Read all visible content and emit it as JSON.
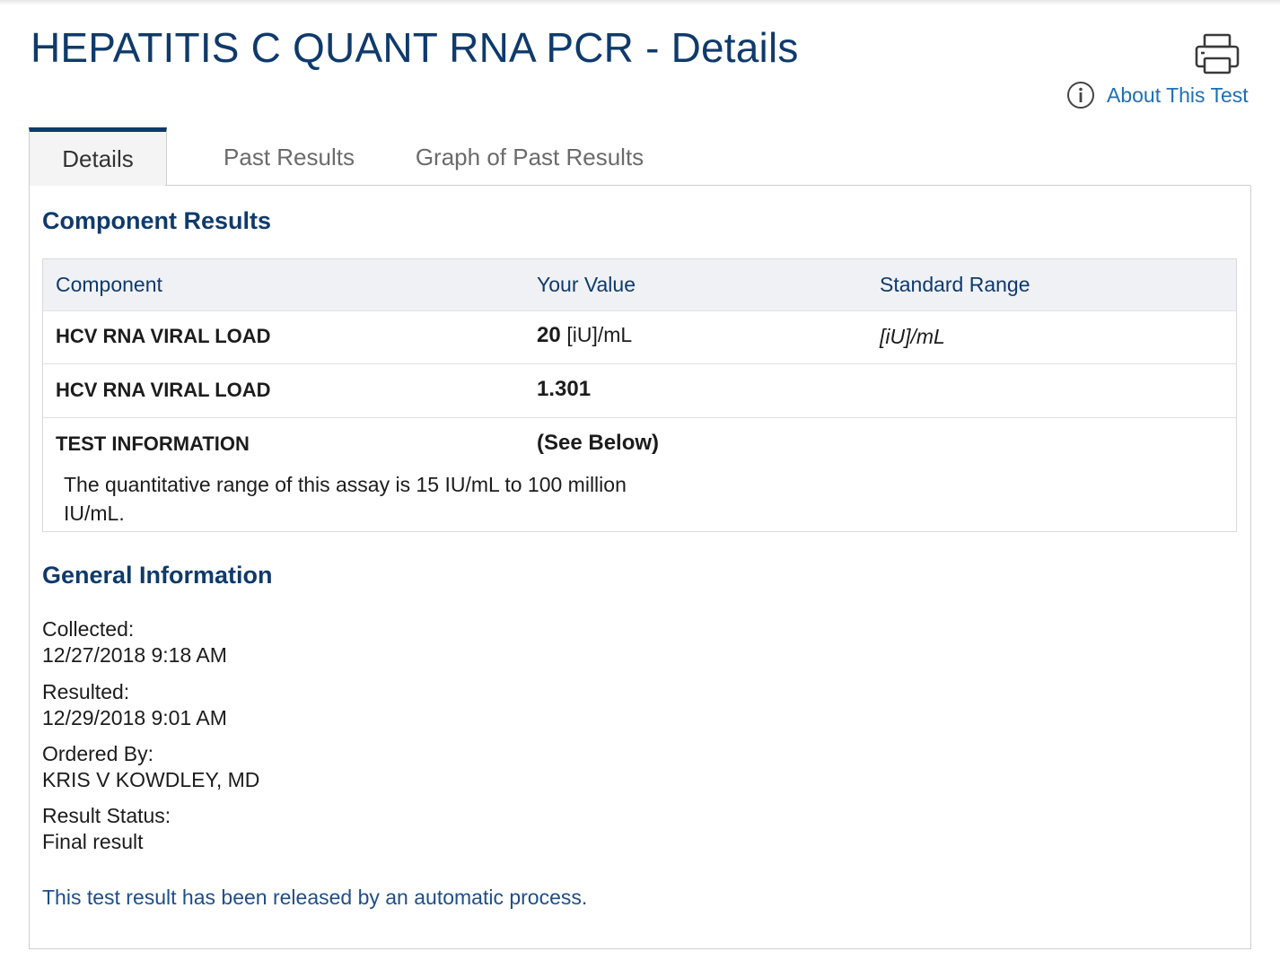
{
  "page": {
    "title": "HEPATITIS C QUANT RNA PCR - Details"
  },
  "header": {
    "print_icon": "printer-icon",
    "about_icon": "info-circle-icon",
    "about_label": "About This Test"
  },
  "tabs": [
    {
      "label": "Details",
      "active": true
    },
    {
      "label": "Past Results",
      "active": false
    },
    {
      "label": "Graph of Past Results",
      "active": false
    }
  ],
  "component_results": {
    "heading": "Component Results",
    "columns": [
      "Component",
      "Your Value",
      "Standard Range"
    ],
    "rows": [
      {
        "component": "HCV RNA VIRAL LOAD",
        "value": "20",
        "unit": "[iU]/mL",
        "range": "[iU]/mL"
      },
      {
        "component": "HCV RNA VIRAL LOAD",
        "value": "1.301",
        "unit": "",
        "range": ""
      },
      {
        "component": "TEST INFORMATION",
        "value": "(See Below)",
        "unit": "",
        "range": "",
        "note": "The quantitative range of this assay is 15 IU/mL to 100 million IU/mL."
      }
    ]
  },
  "general_information": {
    "heading": "General Information",
    "items": [
      {
        "label": "Collected:",
        "value": "12/27/2018 9:18 AM"
      },
      {
        "label": "Resulted:",
        "value": "12/29/2018 9:01 AM"
      },
      {
        "label": "Ordered By:",
        "value": "KRIS V KOWDLEY, MD"
      },
      {
        "label": "Result Status:",
        "value": "Final result"
      }
    ],
    "footer_note": "This test result has been released by an automatic process."
  },
  "colors": {
    "title_navy": "#0f3a6b",
    "link_blue": "#1f6fb3",
    "table_header_bg": "#eff1f5"
  }
}
